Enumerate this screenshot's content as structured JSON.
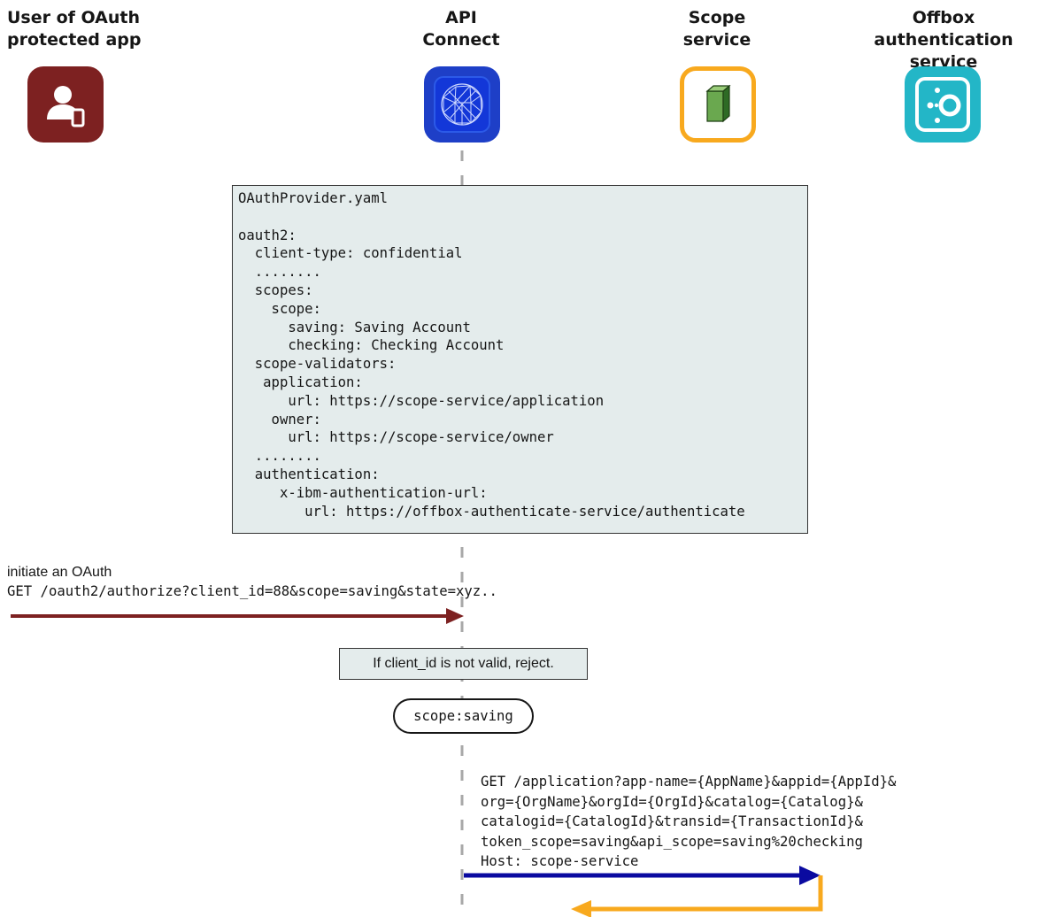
{
  "participants": [
    {
      "id": "user",
      "title": "User of OAuth\nprotected app",
      "icon": "user-icon",
      "color": "#7d2121"
    },
    {
      "id": "apic",
      "title": "API\nConnect",
      "icon": "network-globe-icon",
      "color": "#1e3fc7"
    },
    {
      "id": "scope",
      "title": "Scope\nservice",
      "icon": "box-icon",
      "color": "#f8a91e"
    },
    {
      "id": "offbox",
      "title": "Offbox authentication\nservice",
      "icon": "auth-service-icon",
      "color": "#23b6c7"
    }
  ],
  "config_box": {
    "text": "OAuthProvider.yaml\n\noauth2:\n  client-type: confidential\n  ........\n  scopes:\n    scope:\n      saving: Saving Account\n      checking: Checking Account\n  scope-validators:\n   application:\n      url: https://scope-service/application\n    owner:\n      url: https://scope-service/owner\n  ........\n  authentication:\n     x-ibm-authentication-url:\n        url: https://offbox-authenticate-service/authenticate"
  },
  "steps": {
    "initiate_label": "initiate an OAuth",
    "initiate_request": "GET /oauth2/authorize?client_id=88&scope=saving&state=xyz..",
    "validate_note": "If client_id is not valid, reject.",
    "scope_pill": "scope:saving",
    "scope_request": "GET /application?app-name={AppName}&appid={AppId}&\norg={OrgName}&orgId={OrgId}&catalog={Catalog}&\ncatalogid={CatalogId}&transid={TransactionId}&\ntoken_scope=saving&api_scope=saving%20checking\nHost: scope-service"
  },
  "colors": {
    "user_arrow": "#7d2121",
    "request_arrow": "#0a0aa0",
    "response_arrow": "#f8a91e",
    "lifeline": "#a8a8a8"
  }
}
